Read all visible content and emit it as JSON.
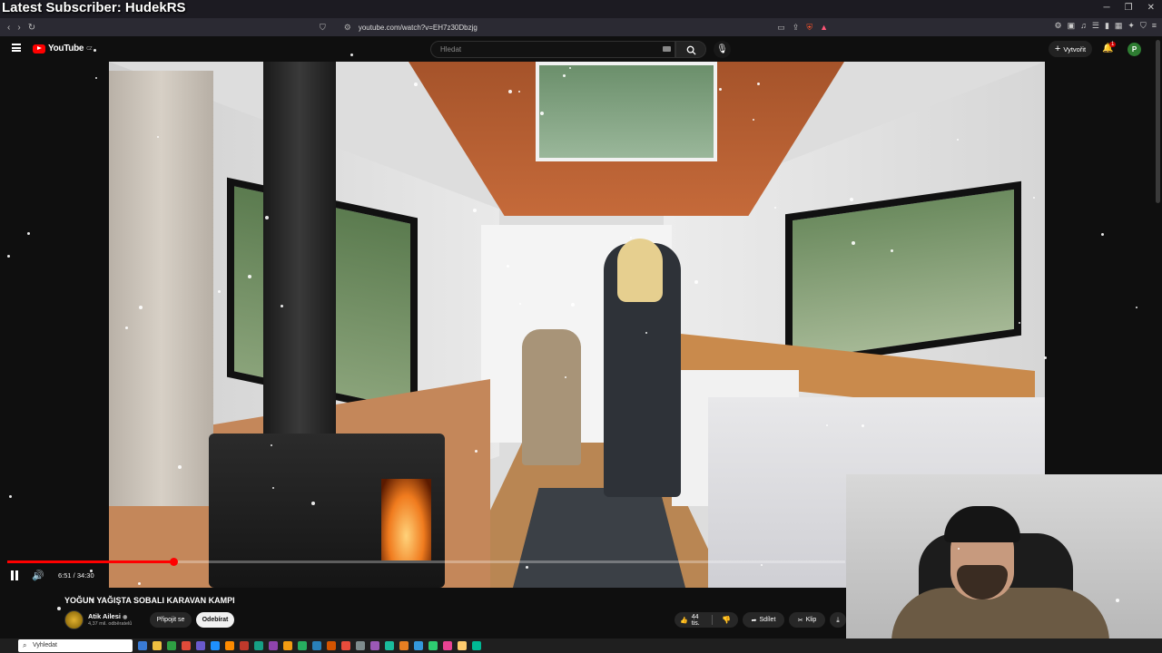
{
  "overlay": {
    "title": "Latest Subscriber: HudekRS"
  },
  "browser": {
    "url": "youtube.com/watch?v=EH7z30Dbzjg",
    "window_controls": [
      "─",
      "❐",
      "✕"
    ]
  },
  "youtube": {
    "logo_text": "YouTube",
    "region": "CZ",
    "search_placeholder": "Hledat",
    "create_label": "Vytvořit",
    "notification_count": "1",
    "avatar_letter": "P"
  },
  "player": {
    "time": "6:51 / 34:30",
    "progress": 0.198
  },
  "video": {
    "title": "YOĞUN YAĞIŞTA SOBALI KARAVAN KAMPI",
    "channel": "Atik Ailesi",
    "subscribers": "4,37 mil. odběratelů",
    "join_label": "Připojit se",
    "subscribe_label": "Odebírat",
    "likes": "44 tis.",
    "share_label": "Sdílet",
    "clip_label": "Klip"
  },
  "taskbar": {
    "search_placeholder": "Vyhledat",
    "icon_colors": [
      "#3a7bd5",
      "#f0c040",
      "#2ea043",
      "#e04b3a",
      "#6a5acd",
      "#1e90ff",
      "#ff8c00",
      "#c0392b",
      "#16a085",
      "#8e44ad",
      "#f39c12",
      "#27ae60",
      "#2980b9",
      "#d35400",
      "#e74c3c",
      "#7f8c8d",
      "#9b59b6",
      "#1abc9c",
      "#e67e22",
      "#3498db",
      "#2ecc71",
      "#e84393",
      "#fdcb6e",
      "#00b894"
    ]
  },
  "colors": {
    "accent": "#ff0000",
    "background": "#0f0f0f"
  }
}
